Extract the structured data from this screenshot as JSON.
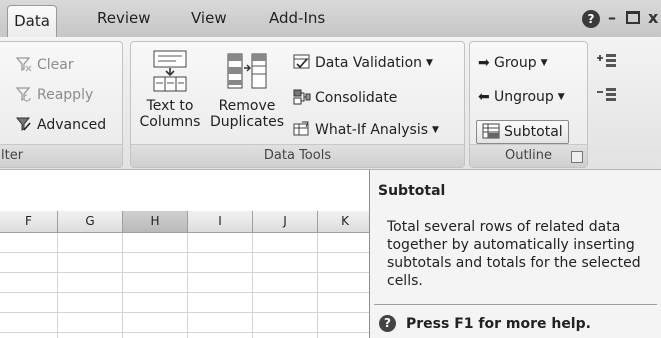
{
  "tabs": [
    {
      "label": "Data",
      "active": true
    },
    {
      "label": "Review",
      "active": false
    },
    {
      "label": "View",
      "active": false
    },
    {
      "label": "Add-Ins",
      "active": false
    }
  ],
  "window_controls": {
    "help": "?",
    "minimize": "–",
    "restore": "▫",
    "close": "x"
  },
  "ribbon": {
    "filter_group": {
      "label": "lter",
      "items": [
        {
          "label": "Clear",
          "icon": "clear-filter-icon",
          "enabled": false
        },
        {
          "label": "Reapply",
          "icon": "reapply-filter-icon",
          "enabled": false
        },
        {
          "label": "Advanced",
          "icon": "advanced-filter-icon",
          "enabled": true
        }
      ]
    },
    "data_tools": {
      "label": "Data Tools",
      "text_to_columns": {
        "line1": "Text to",
        "line2": "Columns"
      },
      "remove_duplicates": {
        "line1": "Remove",
        "line2": "Duplicates"
      },
      "data_validation": "Data Validation",
      "consolidate": "Consolidate",
      "what_if": "What-If Analysis"
    },
    "outline": {
      "label": "Outline",
      "group": "Group",
      "ungroup": "Ungroup",
      "subtotal": "Subtotal"
    }
  },
  "sheet": {
    "columns": [
      "F",
      "G",
      "H",
      "I",
      "J",
      "K"
    ],
    "selected_column": "H"
  },
  "tooltip": {
    "title": "Subtotal",
    "body": "Total several rows of related data together by automatically inserting subtotals and totals for the selected cells.",
    "help": "Press F1 for more help."
  },
  "colors": {
    "ribbon_bg": "#e9e9e9",
    "tooltip_bg": "#f4f4f4",
    "selected_header": "#c4c4c4"
  }
}
